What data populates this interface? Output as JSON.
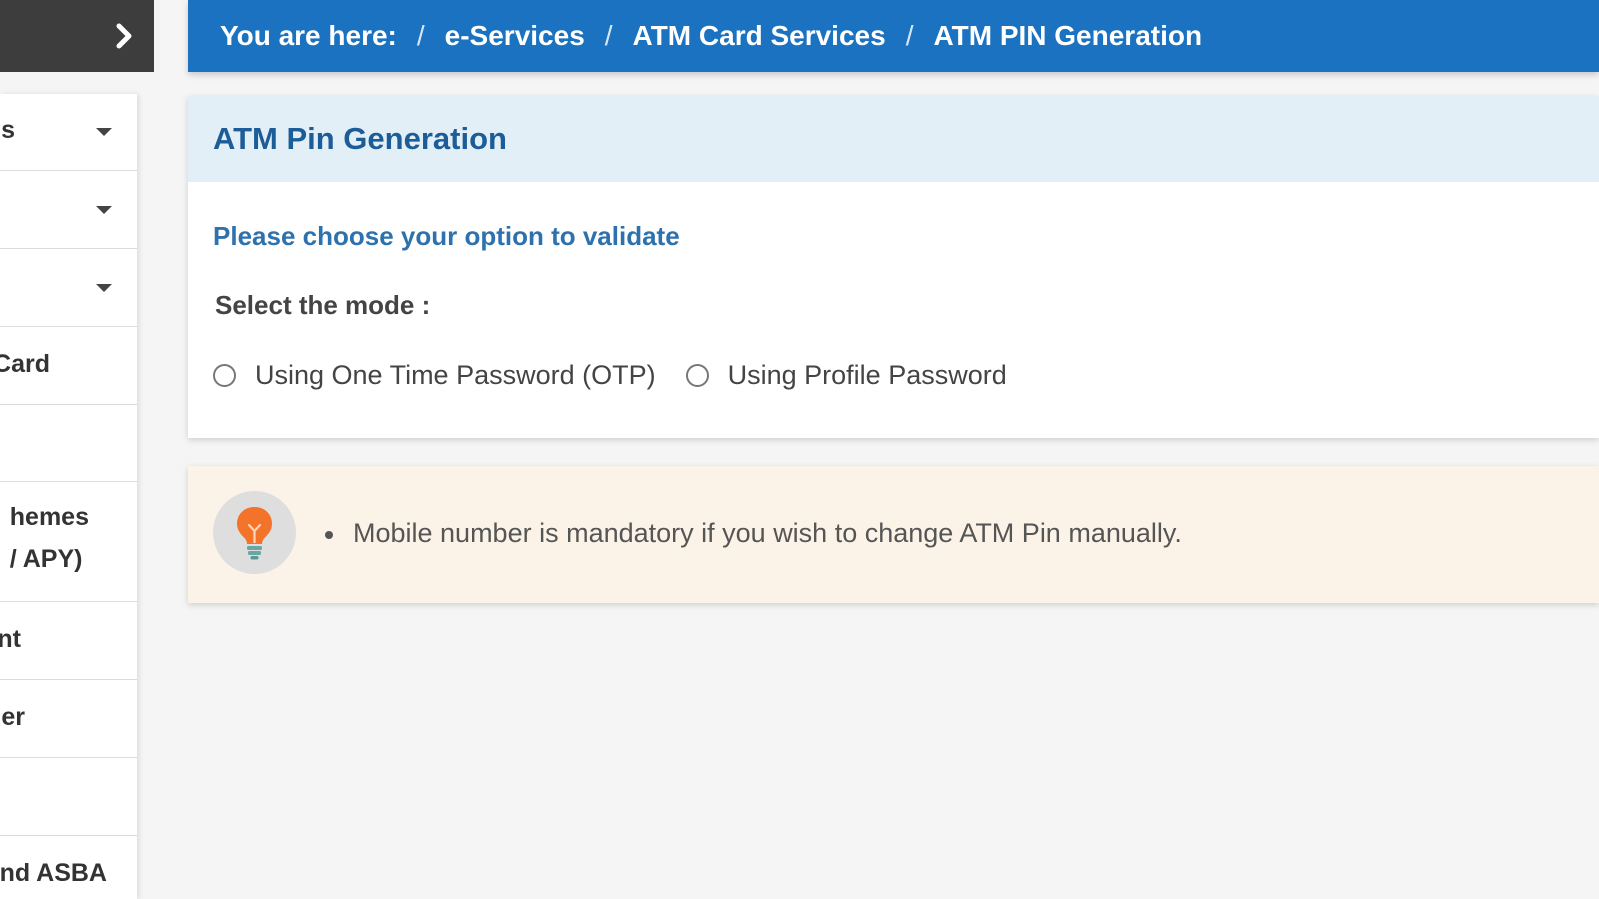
{
  "sidebar": {
    "items": [
      {
        "label": "s",
        "has_caret": true
      },
      {
        "label": "",
        "has_caret": true
      },
      {
        "label": "",
        "has_caret": true
      },
      {
        "label": "Card",
        "has_caret": false
      },
      {
        "label": "",
        "has_caret": false
      },
      {
        "label": "hemes\n/ APY)",
        "has_caret": false
      },
      {
        "label": "nt",
        "has_caret": false
      },
      {
        "label": "er",
        "has_caret": false
      },
      {
        "label": "",
        "has_caret": false
      },
      {
        "label": "nd ASBA",
        "has_caret": false
      }
    ]
  },
  "breadcrumb": {
    "prefix": "You are here:",
    "separator": "/",
    "items": [
      "e-Services",
      "ATM Card Services",
      "ATM PIN Generation"
    ]
  },
  "card": {
    "title": "ATM Pin Generation",
    "subtitle": "Please choose your option to validate",
    "mode_label": "Select the mode :",
    "options": [
      "Using One Time Password (OTP)",
      "Using Profile Password"
    ]
  },
  "info": {
    "icon": "lightbulb-icon",
    "items": [
      "Mobile number is mandatory if you wish to change ATM Pin manually."
    ]
  },
  "colors": {
    "breadcrumb_bg": "#1a72c0",
    "card_header_bg": "#e3eff7",
    "title_text": "#1c5d98",
    "info_bg": "#fbf3e8",
    "bulb": "#f4732a"
  }
}
